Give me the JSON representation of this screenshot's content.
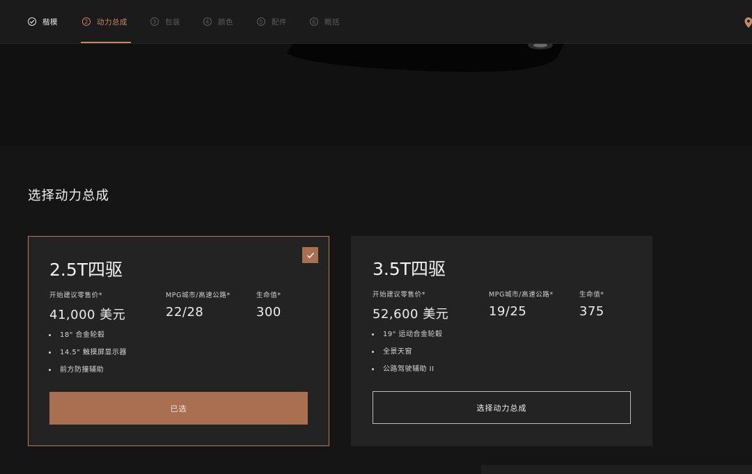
{
  "nav": {
    "steps": [
      {
        "num": "",
        "label": "楷模",
        "state": "done",
        "icon": "check-circle-icon"
      },
      {
        "num": "2",
        "label": "动力总成",
        "state": "active"
      },
      {
        "num": "3",
        "label": "包装",
        "state": "todo"
      },
      {
        "num": "4",
        "label": "颜色",
        "state": "todo"
      },
      {
        "num": "5",
        "label": "配件",
        "state": "todo"
      },
      {
        "num": "6",
        "label": "概括",
        "state": "todo"
      }
    ],
    "location_icon": "location-pin-icon"
  },
  "section": {
    "title": "选择动力总成"
  },
  "cards": [
    {
      "name": "2.5T四驱",
      "selected": true,
      "specs": [
        {
          "label": "开始建议零售价*",
          "value": "41,000 美元"
        },
        {
          "label": "MPG城市/高速公路*",
          "value": "22/28"
        },
        {
          "label": "生命值*",
          "value": "300"
        }
      ],
      "features": [
        "18\" 合金轮毂",
        "14.5\" 触摸屏显示器",
        "前方防撞辅助"
      ],
      "button_label": "已选"
    },
    {
      "name": "3.5T四驱",
      "selected": false,
      "specs": [
        {
          "label": "开始建议零售价*",
          "value": "52,600 美元"
        },
        {
          "label": "MPG城市/高速公路*",
          "value": "19/25"
        },
        {
          "label": "生命值*",
          "value": "375"
        }
      ],
      "features": [
        "19\" 运动合金轮毂",
        "全景天窗",
        "公路驾驶辅助 II"
      ],
      "button_label": "选择动力总成"
    }
  ],
  "colors": {
    "accent": "#c98960",
    "button_fill": "#a86f51",
    "background": "#151515",
    "card": "#232323"
  }
}
